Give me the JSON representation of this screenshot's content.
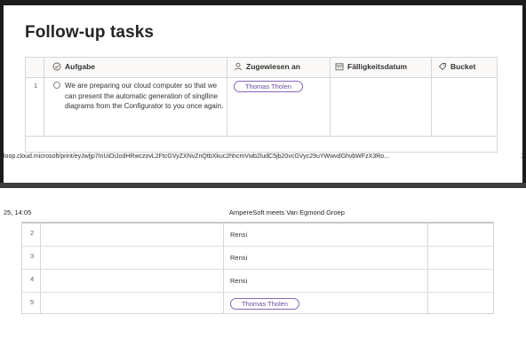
{
  "title": "Follow-up tasks",
  "columns": [
    {
      "label": "Aufgabe",
      "icon": "circle-check-icon"
    },
    {
      "label": "Zugewiesen an",
      "icon": "person-icon"
    },
    {
      "label": "Fälligkeitsdatum",
      "icon": "calendar-icon"
    },
    {
      "label": "Bucket",
      "icon": "tag-icon"
    }
  ],
  "tasks_top": [
    {
      "num": "1",
      "text": "We are preparing our cloud computer so that we can present the automatic generation of singlline diagrams from the Configurator to you once again.",
      "assignee": "Thomas Tholen"
    }
  ],
  "print_url": "loop.cloud.microsoft/print/eyJwljp7InUiOiJodHRwczovL2FtcGVyZXNvZnQtbXkuc2hhcmVwb2ludC5jb20vcGVyc29uYWwvdGhvbWFzX3Ro...",
  "page_number": "1",
  "header_left": "25, 14:05",
  "header_center": "AmpereSoft meets Van Egmond Groep",
  "tasks_bottom": [
    {
      "num": "2",
      "assignee": "Rensi"
    },
    {
      "num": "3",
      "assignee": "Rensi"
    },
    {
      "num": "4",
      "assignee": "Rensi"
    },
    {
      "num": "5",
      "assignee": "Thomas Tholen"
    }
  ],
  "colors": {
    "accent": "#8764b8",
    "border": "#d6d6d6"
  }
}
